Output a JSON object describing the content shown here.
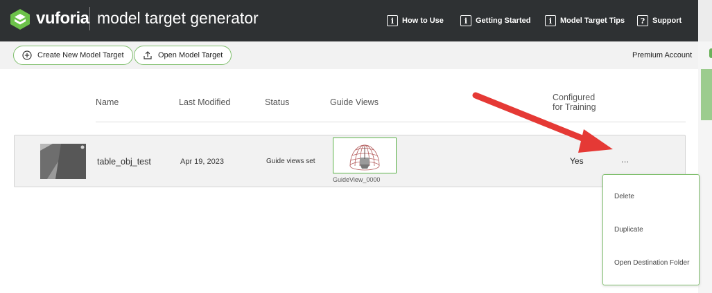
{
  "header": {
    "brand": "vuforia",
    "app_title": "model target generator",
    "nav": [
      {
        "label": "How to Use",
        "icon": "info-icon",
        "glyph": "i"
      },
      {
        "label": "Getting Started",
        "icon": "info-icon",
        "glyph": "i"
      },
      {
        "label": "Model Target Tips",
        "icon": "info-icon",
        "glyph": "i"
      },
      {
        "label": "Support",
        "icon": "question-icon",
        "glyph": "?"
      }
    ]
  },
  "toolbar": {
    "create_label": "Create New Model Target",
    "open_label": "Open Model Target",
    "account": "Premium Account"
  },
  "table": {
    "headers": {
      "name": "Name",
      "last_modified": "Last Modified",
      "status": "Status",
      "guide_views": "Guide Views",
      "configured_line1": "Configured",
      "configured_line2": "for Training"
    },
    "rows": [
      {
        "name": "table_obj_test",
        "last_modified": "Apr 19, 2023",
        "status": "Guide views set",
        "guide_view_label": "GuideView_0000",
        "configured": "Yes",
        "more": "..."
      }
    ]
  },
  "context_menu": {
    "items": [
      "Delete",
      "Duplicate",
      "Open Destination Folder"
    ]
  },
  "colors": {
    "header_bg": "#2e3133",
    "accent_green": "#7fbf6c",
    "arrow_red": "#e53935"
  }
}
